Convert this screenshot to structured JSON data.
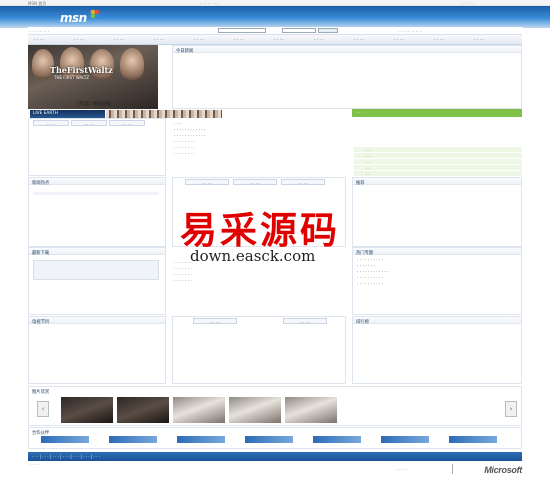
{
  "watermark": {
    "chinese": "易采源码",
    "url": "down.easck.com"
  },
  "branding": {
    "msn_logo": "msn",
    "microsoft_logo": "Microsoft"
  },
  "colors": {
    "header_blue": "#2f7fc8",
    "accent_green": "#7ec24a",
    "watermark_red": "#e00000",
    "footer_blue": "#1b5297"
  },
  "hero": {
    "title": "TheFirstWaltz",
    "subtitle": "THE FIRST WALTZ",
    "caption": "《夜宴》精彩剧照"
  },
  "live": {
    "badge": "LIVE EARTH"
  },
  "sections": {
    "today": "今日新闻",
    "music": "新闻热点",
    "download": "最新下载",
    "recommend": "推荐",
    "tv": "电视节目",
    "gallery": "图片欣赏",
    "friends": "合作伙伴",
    "ranking": "排行榜",
    "hot": "热门专题"
  },
  "icons": {
    "butterfly": "msn-butterfly-icon",
    "left_arrow": "chevron-left-icon",
    "right_arrow": "chevron-right-icon"
  }
}
